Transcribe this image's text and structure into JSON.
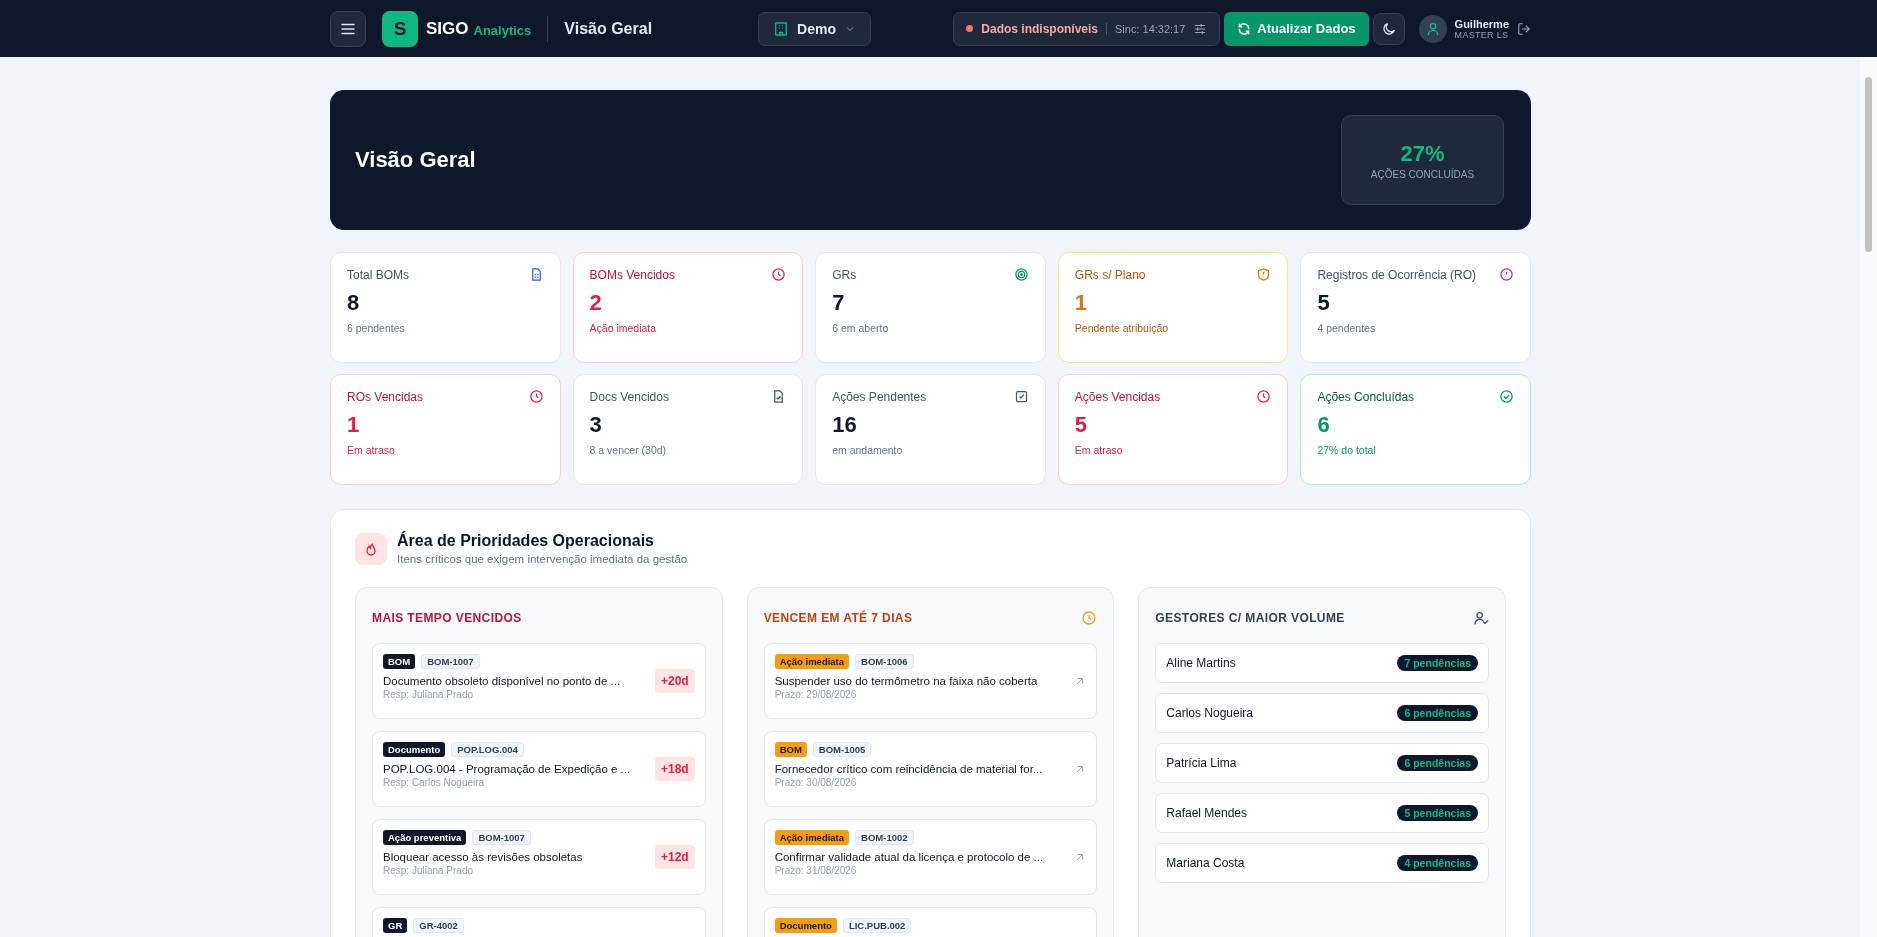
{
  "header": {
    "brand": {
      "logo": "S",
      "name": "SIGO",
      "suffix": "Analytics"
    },
    "page_title": "Visão Geral",
    "workspace": "Demo",
    "status": {
      "online": false,
      "label": "Dados indisponíveis",
      "sync": "Sinc: 14:32:17"
    },
    "refresh_button": "Atualizar Dados",
    "user": {
      "name": "Guilherme",
      "role": "MASTER LS"
    }
  },
  "hero": {
    "title": "Visão Geral",
    "metric": {
      "value": "27%",
      "label": "AÇÕES CONCLUÍDAS"
    }
  },
  "stats": [
    {
      "title": "Total BOMs",
      "value": "8",
      "note": "6 pendentes",
      "kind": "default"
    },
    {
      "title": "BOMs Vencidos",
      "value": "2",
      "note": "Ação imediata",
      "kind": "danger"
    },
    {
      "title": "GRs",
      "value": "7",
      "note": "6 em aberto",
      "kind": "default"
    },
    {
      "title": "GRs s/ Plano",
      "value": "1",
      "note": "Pendente atribuição",
      "kind": "warning"
    },
    {
      "title": "Registros de Ocorrência (RO)",
      "value": "5",
      "note": "4 pendentes",
      "kind": "default"
    },
    {
      "title": "ROs Vencidas",
      "value": "1",
      "note": "Em atraso",
      "kind": "danger"
    },
    {
      "title": "Docs Vencidos",
      "value": "3",
      "note": "8 a vencer (30d)",
      "kind": "default"
    },
    {
      "title": "Ações Pendentes",
      "value": "16",
      "note": "em andamento",
      "kind": "default"
    },
    {
      "title": "Ações Vencidas",
      "value": "5",
      "note": "Em atraso",
      "kind": "danger"
    },
    {
      "title": "Ações Concluídas",
      "value": "6",
      "note": "27% do total",
      "kind": "success"
    }
  ],
  "priorities": {
    "title": "Área de Prioridades Operacionais",
    "subtitle": "Itens críticos que exigem intervenção imediata da gestão",
    "columns": [
      {
        "kind": "overdue",
        "title": "MAIS TEMPO VENCIDOS",
        "items": [
          {
            "tag": "BOM",
            "code": "BOM-1007",
            "title": "Documento obsoleto disponível no ponto de ...",
            "detail": "Resp: Juliana Prado",
            "badge": "+20d"
          },
          {
            "tag": "Documento",
            "code": "POP.LOG.004",
            "title": "POP.LOG.004 - Programação de Expedição e ...",
            "detail": "Resp: Carlos Nogueira",
            "badge": "+18d"
          },
          {
            "tag": "Ação preventiva",
            "code": "BOM-1007",
            "title": "Bloquear acesso às revisões obsoletas",
            "detail": "Resp: Juliana Prado",
            "badge": "+12d"
          },
          {
            "tag": "GR",
            "code": "GR-4002"
          }
        ]
      },
      {
        "kind": "upcoming",
        "title": "VENCEM EM ATÉ 7 DIAS",
        "items": [
          {
            "tag": "Ação imediata",
            "code": "BOM-1006",
            "title": "Suspender uso do termômetro na faixa não coberta",
            "detail": "Prazo: 29/08/2026"
          },
          {
            "tag": "BOM",
            "code": "BOM-1005",
            "title": "Fornecedor crítico com reincidência de material for...",
            "detail": "Prazo: 30/08/2026"
          },
          {
            "tag": "Ação imediata",
            "code": "BOM-1002",
            "title": "Confirmar validade atual da licença e protocolo de ...",
            "detail": "Prazo: 31/08/2026"
          },
          {
            "tag": "Documento",
            "code": "LIC.PUB.002"
          }
        ]
      },
      {
        "kind": "managers",
        "title": "GESTORES C/ MAIOR VOLUME",
        "items": [
          {
            "name": "Aline Martins",
            "count": "7 pendências"
          },
          {
            "name": "Carlos Nogueira",
            "count": "6 pendências"
          },
          {
            "name": "Patrícia Lima",
            "count": "6 pendências"
          },
          {
            "name": "Rafael Mendes",
            "count": "5 pendências"
          },
          {
            "name": "Mariana Costa",
            "count": "4 pendências"
          }
        ]
      }
    ]
  }
}
